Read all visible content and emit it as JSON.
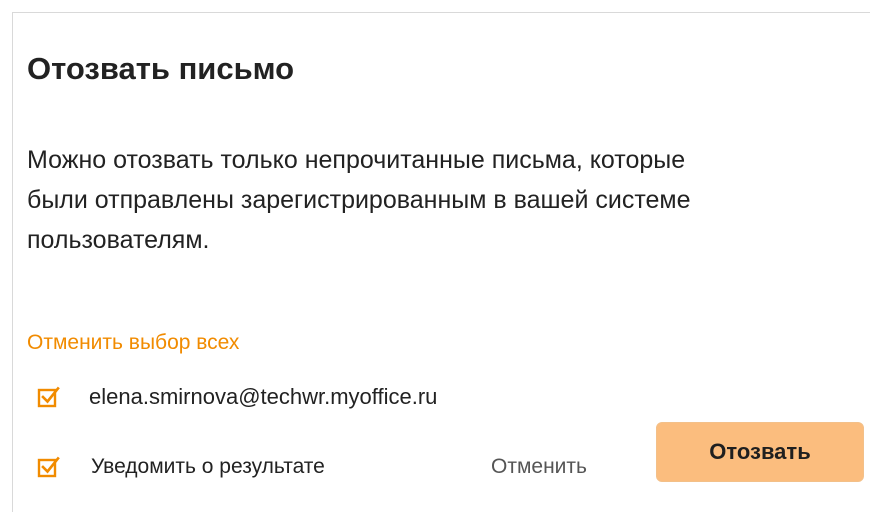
{
  "dialog": {
    "title": "Отозвать письмо",
    "description_lines": [
      "Можно отозвать только непрочитанные письма, которые",
      "были отправлены зарегистрированным в вашей системе",
      "пользователям."
    ],
    "deselect_all_label": "Отменить выбор всех",
    "recipients": [
      {
        "email": "elena.smirnova@techwr.myoffice.ru",
        "checked": true
      }
    ],
    "notify": {
      "label": "Уведомить о результате",
      "checked": true
    },
    "cancel_label": "Отменить",
    "recall_label": "Отозвать"
  },
  "colors": {
    "accent": "#f18b00",
    "primary_button": "#fbbd7e",
    "text": "#222222"
  },
  "icons": {
    "checkbox": "checkbox-checked-icon"
  }
}
